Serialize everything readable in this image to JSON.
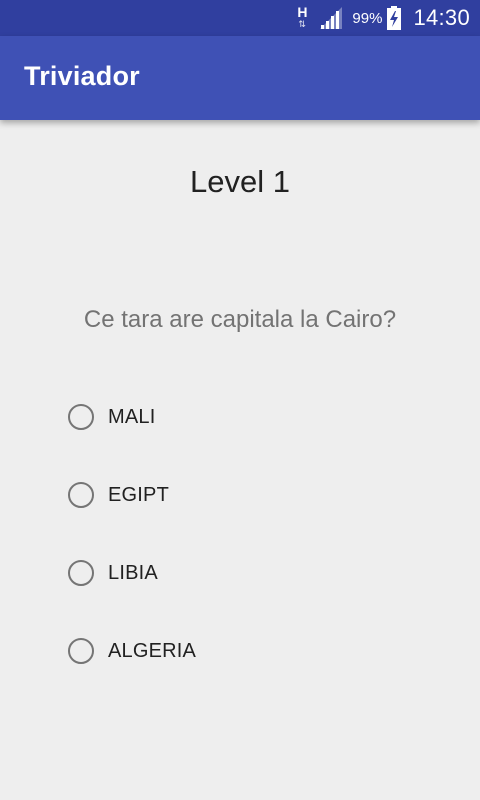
{
  "status_bar": {
    "network_type": "H",
    "network_arrows": "⇅",
    "battery_percent": "99%",
    "time": "14:30",
    "icons": [
      "signal-icon",
      "battery-charging-icon"
    ]
  },
  "app_bar": {
    "title": "Triviador",
    "color": "#3f51b5",
    "status_color": "#303f9f"
  },
  "quiz": {
    "level": "Level 1",
    "question": "Ce tara are capitala la Cairo?",
    "options": [
      {
        "label": "MALI",
        "selected": false
      },
      {
        "label": "EGIPT",
        "selected": false
      },
      {
        "label": "LIBIA",
        "selected": false
      },
      {
        "label": "ALGERIA",
        "selected": false
      }
    ]
  }
}
